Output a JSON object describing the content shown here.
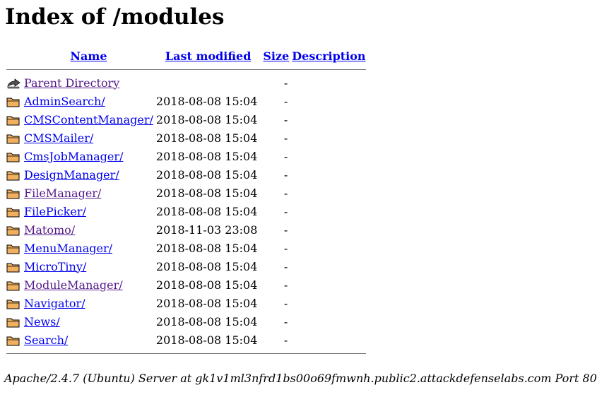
{
  "page": {
    "title": "Index of /modules"
  },
  "table": {
    "headers": {
      "name": "Name",
      "last_modified": "Last modified",
      "size": "Size",
      "description": "Description"
    },
    "parent": {
      "name": "Parent Directory",
      "size": "-",
      "icon": "back-arrow-icon",
      "visited": true
    },
    "rows": [
      {
        "name": "AdminSearch/",
        "modified": "2018-08-08 15:04",
        "size": "-",
        "visited": false
      },
      {
        "name": "CMSContentManager/",
        "modified": "2018-08-08 15:04",
        "size": "-",
        "visited": false
      },
      {
        "name": "CMSMailer/",
        "modified": "2018-08-08 15:04",
        "size": "-",
        "visited": false
      },
      {
        "name": "CmsJobManager/",
        "modified": "2018-08-08 15:04",
        "size": "-",
        "visited": false
      },
      {
        "name": "DesignManager/",
        "modified": "2018-08-08 15:04",
        "size": "-",
        "visited": false
      },
      {
        "name": "FileManager/",
        "modified": "2018-08-08 15:04",
        "size": "-",
        "visited": true
      },
      {
        "name": "FilePicker/",
        "modified": "2018-08-08 15:04",
        "size": "-",
        "visited": false
      },
      {
        "name": "Matomo/",
        "modified": "2018-11-03 23:08",
        "size": "-",
        "visited": true
      },
      {
        "name": "MenuManager/",
        "modified": "2018-08-08 15:04",
        "size": "-",
        "visited": false
      },
      {
        "name": "MicroTiny/",
        "modified": "2018-08-08 15:04",
        "size": "-",
        "visited": false
      },
      {
        "name": "ModuleManager/",
        "modified": "2018-08-08 15:04",
        "size": "-",
        "visited": true
      },
      {
        "name": "Navigator/",
        "modified": "2018-08-08 15:04",
        "size": "-",
        "visited": false
      },
      {
        "name": "News/",
        "modified": "2018-08-08 15:04",
        "size": "-",
        "visited": false
      },
      {
        "name": "Search/",
        "modified": "2018-08-08 15:04",
        "size": "-",
        "visited": false
      }
    ]
  },
  "footer": {
    "address": "Apache/2.4.7 (Ubuntu) Server at gk1v1ml3nfrd1bs00o69fmwnh.public2.attackdefenselabs.com Port 80"
  },
  "colors": {
    "link": "#0000ee",
    "visited": "#551a8b",
    "folder_fill": "#f0b060"
  }
}
